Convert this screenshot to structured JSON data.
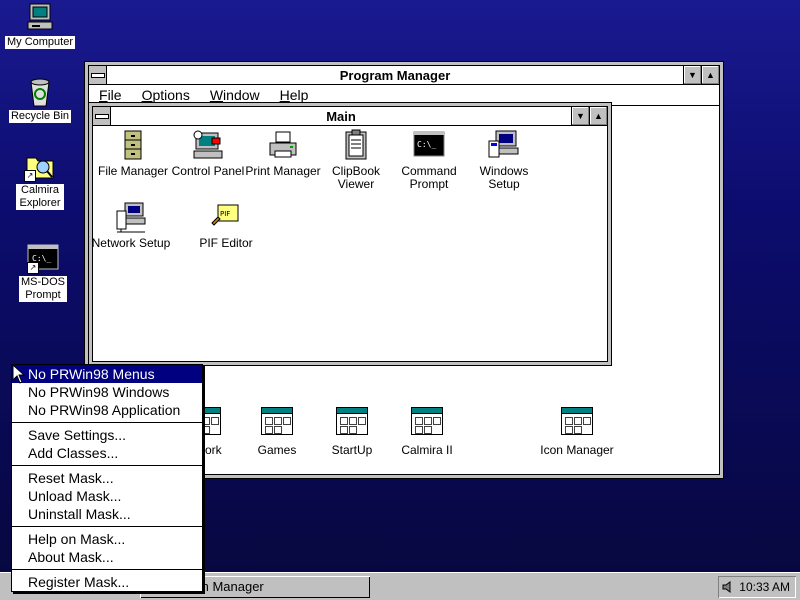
{
  "desktop": {
    "icons": [
      {
        "label": "My Computer",
        "icon": "computer-icon"
      },
      {
        "label": "Recycle Bin",
        "icon": "recycle-bin-icon"
      },
      {
        "label": "Calmira Explorer",
        "icon": "explorer-icon"
      },
      {
        "label": "MS-DOS Prompt",
        "icon": "dos-prompt-icon",
        "glyph": "C:\\_"
      }
    ]
  },
  "program_manager": {
    "title": "Program Manager",
    "menu": [
      "File",
      "Options",
      "Window",
      "Help"
    ],
    "main_window": {
      "title": "Main",
      "icons": [
        {
          "label": "File Manager",
          "icon": "file-cabinet-icon"
        },
        {
          "label": "Control Panel",
          "icon": "control-panel-icon"
        },
        {
          "label": "Print Manager",
          "icon": "printer-icon"
        },
        {
          "label": "ClipBook Viewer",
          "icon": "clipbook-icon"
        },
        {
          "label": "Command Prompt",
          "icon": "command-prompt-icon",
          "glyph": "C:\\_"
        },
        {
          "label": "Windows Setup",
          "icon": "windows-setup-icon"
        },
        {
          "label": "Network Setup",
          "icon": "network-setup-icon"
        },
        {
          "label": "PIF Editor",
          "icon": "pif-editor-icon",
          "glyph": "PIF"
        }
      ]
    },
    "groups": [
      {
        "label": "work",
        "icon": "program-group-icon"
      },
      {
        "label": "Games",
        "icon": "program-group-icon"
      },
      {
        "label": "StartUp",
        "icon": "program-group-icon"
      },
      {
        "label": "Calmira II",
        "icon": "program-group-icon"
      },
      {
        "label": "Icon Manager",
        "icon": "program-group-icon"
      }
    ]
  },
  "context_menu": {
    "items": [
      "No PRWin98 Menus",
      "No PRWin98 Windows",
      "No PRWin98 Application",
      "Save Settings...",
      "Add Classes...",
      "Reset Mask...",
      "Unload Mask...",
      "Uninstall Mask...",
      "Help on Mask...",
      "About Mask...",
      "Register Mask..."
    ],
    "selected_index": 0
  },
  "taskbar": {
    "task_label": "m Manager",
    "clock": "10:33 AM"
  },
  "colors": {
    "desktop_top": "#1a1a90",
    "highlight": "#000080",
    "chrome": "#c0c0c0"
  }
}
